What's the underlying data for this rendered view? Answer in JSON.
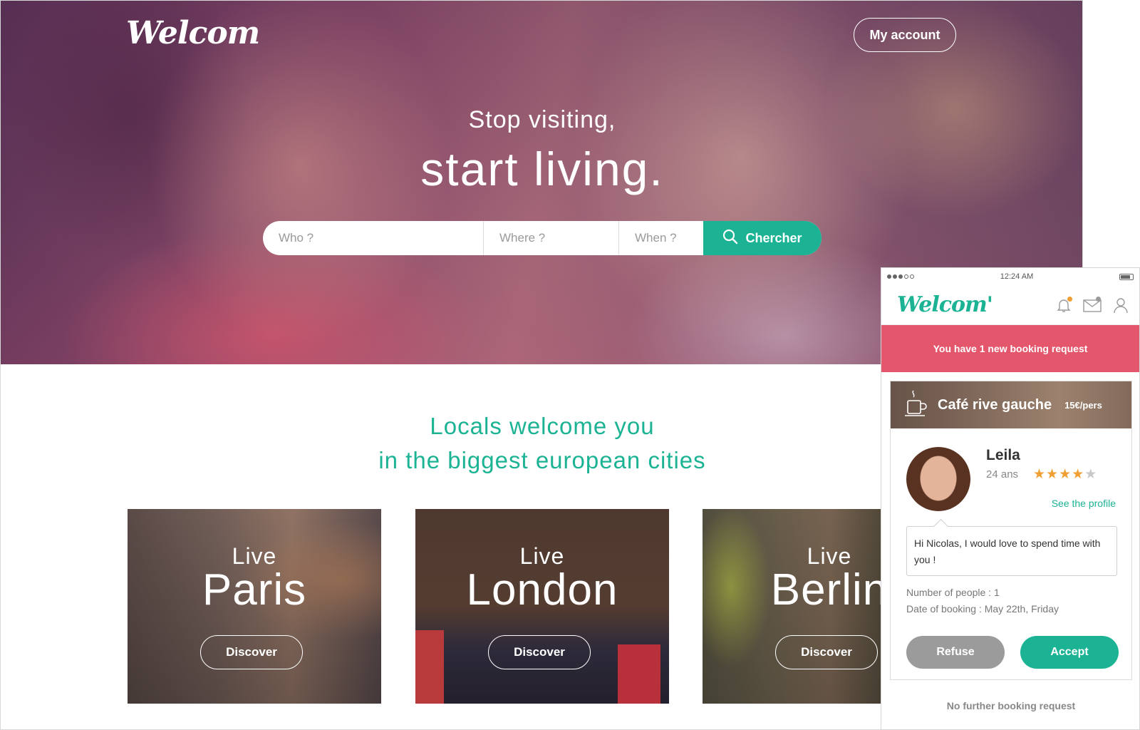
{
  "site": {
    "logo": "Welcom",
    "account_button": "My account",
    "hero": {
      "tagline_line1": "Stop visiting,",
      "tagline_line2": "start living."
    },
    "search": {
      "who_placeholder": "Who ?",
      "where_placeholder": "Where ?",
      "when_placeholder": "When ?",
      "button_label": "Chercher"
    },
    "locals": {
      "line1": "Locals welcome you",
      "line2": "in the biggest european cities"
    },
    "cities": [
      {
        "live": "Live",
        "city": "Paris",
        "button": "Discover"
      },
      {
        "live": "Live",
        "city": "London",
        "button": "Discover"
      },
      {
        "live": "Live",
        "city": "Berlin",
        "button": "Discover"
      }
    ],
    "colors": {
      "accent": "#1bb394",
      "alert": "#e3566c",
      "star": "#f0a033"
    }
  },
  "mobile": {
    "status": {
      "time": "12:24 AM"
    },
    "logo": "Welcom'",
    "icons": [
      "bell-icon",
      "mail-icon",
      "user-icon"
    ],
    "banner": "You have 1 new booking request",
    "request": {
      "place": "Café rive gauche",
      "price": "15€/pers",
      "name": "Leila",
      "age": "24 ans",
      "rating": 4,
      "rating_max": 5,
      "see_profile": "See the profile",
      "message": "Hi Nicolas, I would love to spend time with you !",
      "people": "Number of people : 1",
      "date": "Date of booking : May 22th, Friday",
      "refuse": "Refuse",
      "accept": "Accept"
    },
    "footer": "No further booking request"
  }
}
